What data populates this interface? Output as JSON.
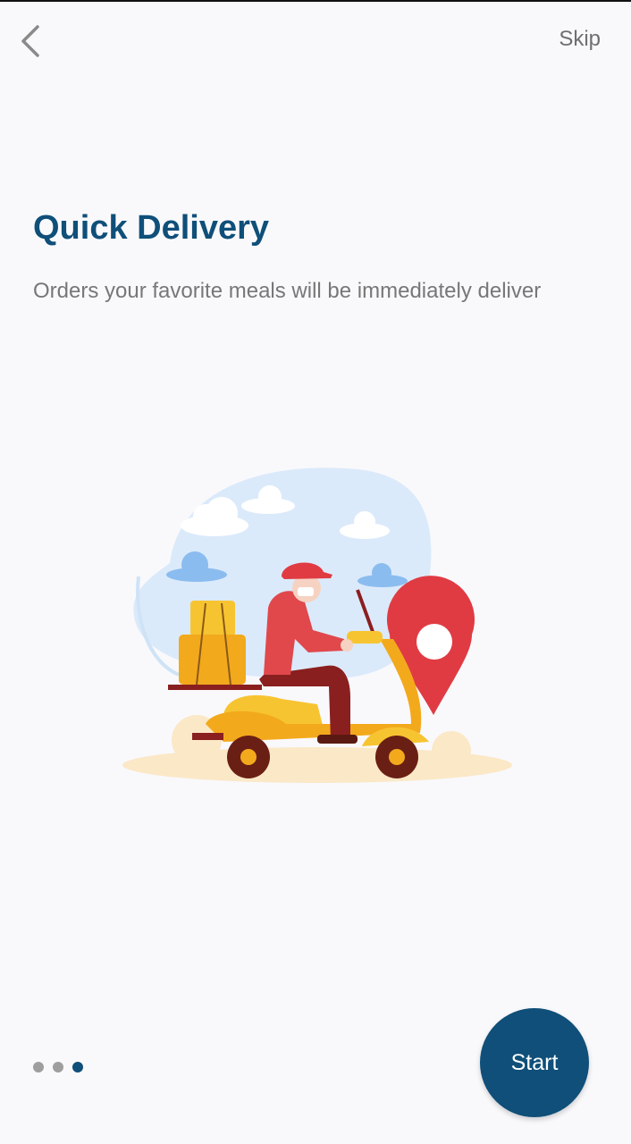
{
  "header": {
    "back_icon": "chevron-left-icon",
    "skip_label": "Skip"
  },
  "content": {
    "title": "Quick Delivery",
    "subtitle": "Orders your favorite meals will be immediately deliver",
    "illustration": "delivery-scooter-illustration"
  },
  "pager": {
    "total": 3,
    "current": 3
  },
  "footer": {
    "start_label": "Start"
  },
  "colors": {
    "primary": "#0f4f79",
    "background": "#f9f9fc",
    "text_muted": "#777777",
    "pin_red": "#e03b43",
    "scooter_yellow": "#f7c431"
  }
}
